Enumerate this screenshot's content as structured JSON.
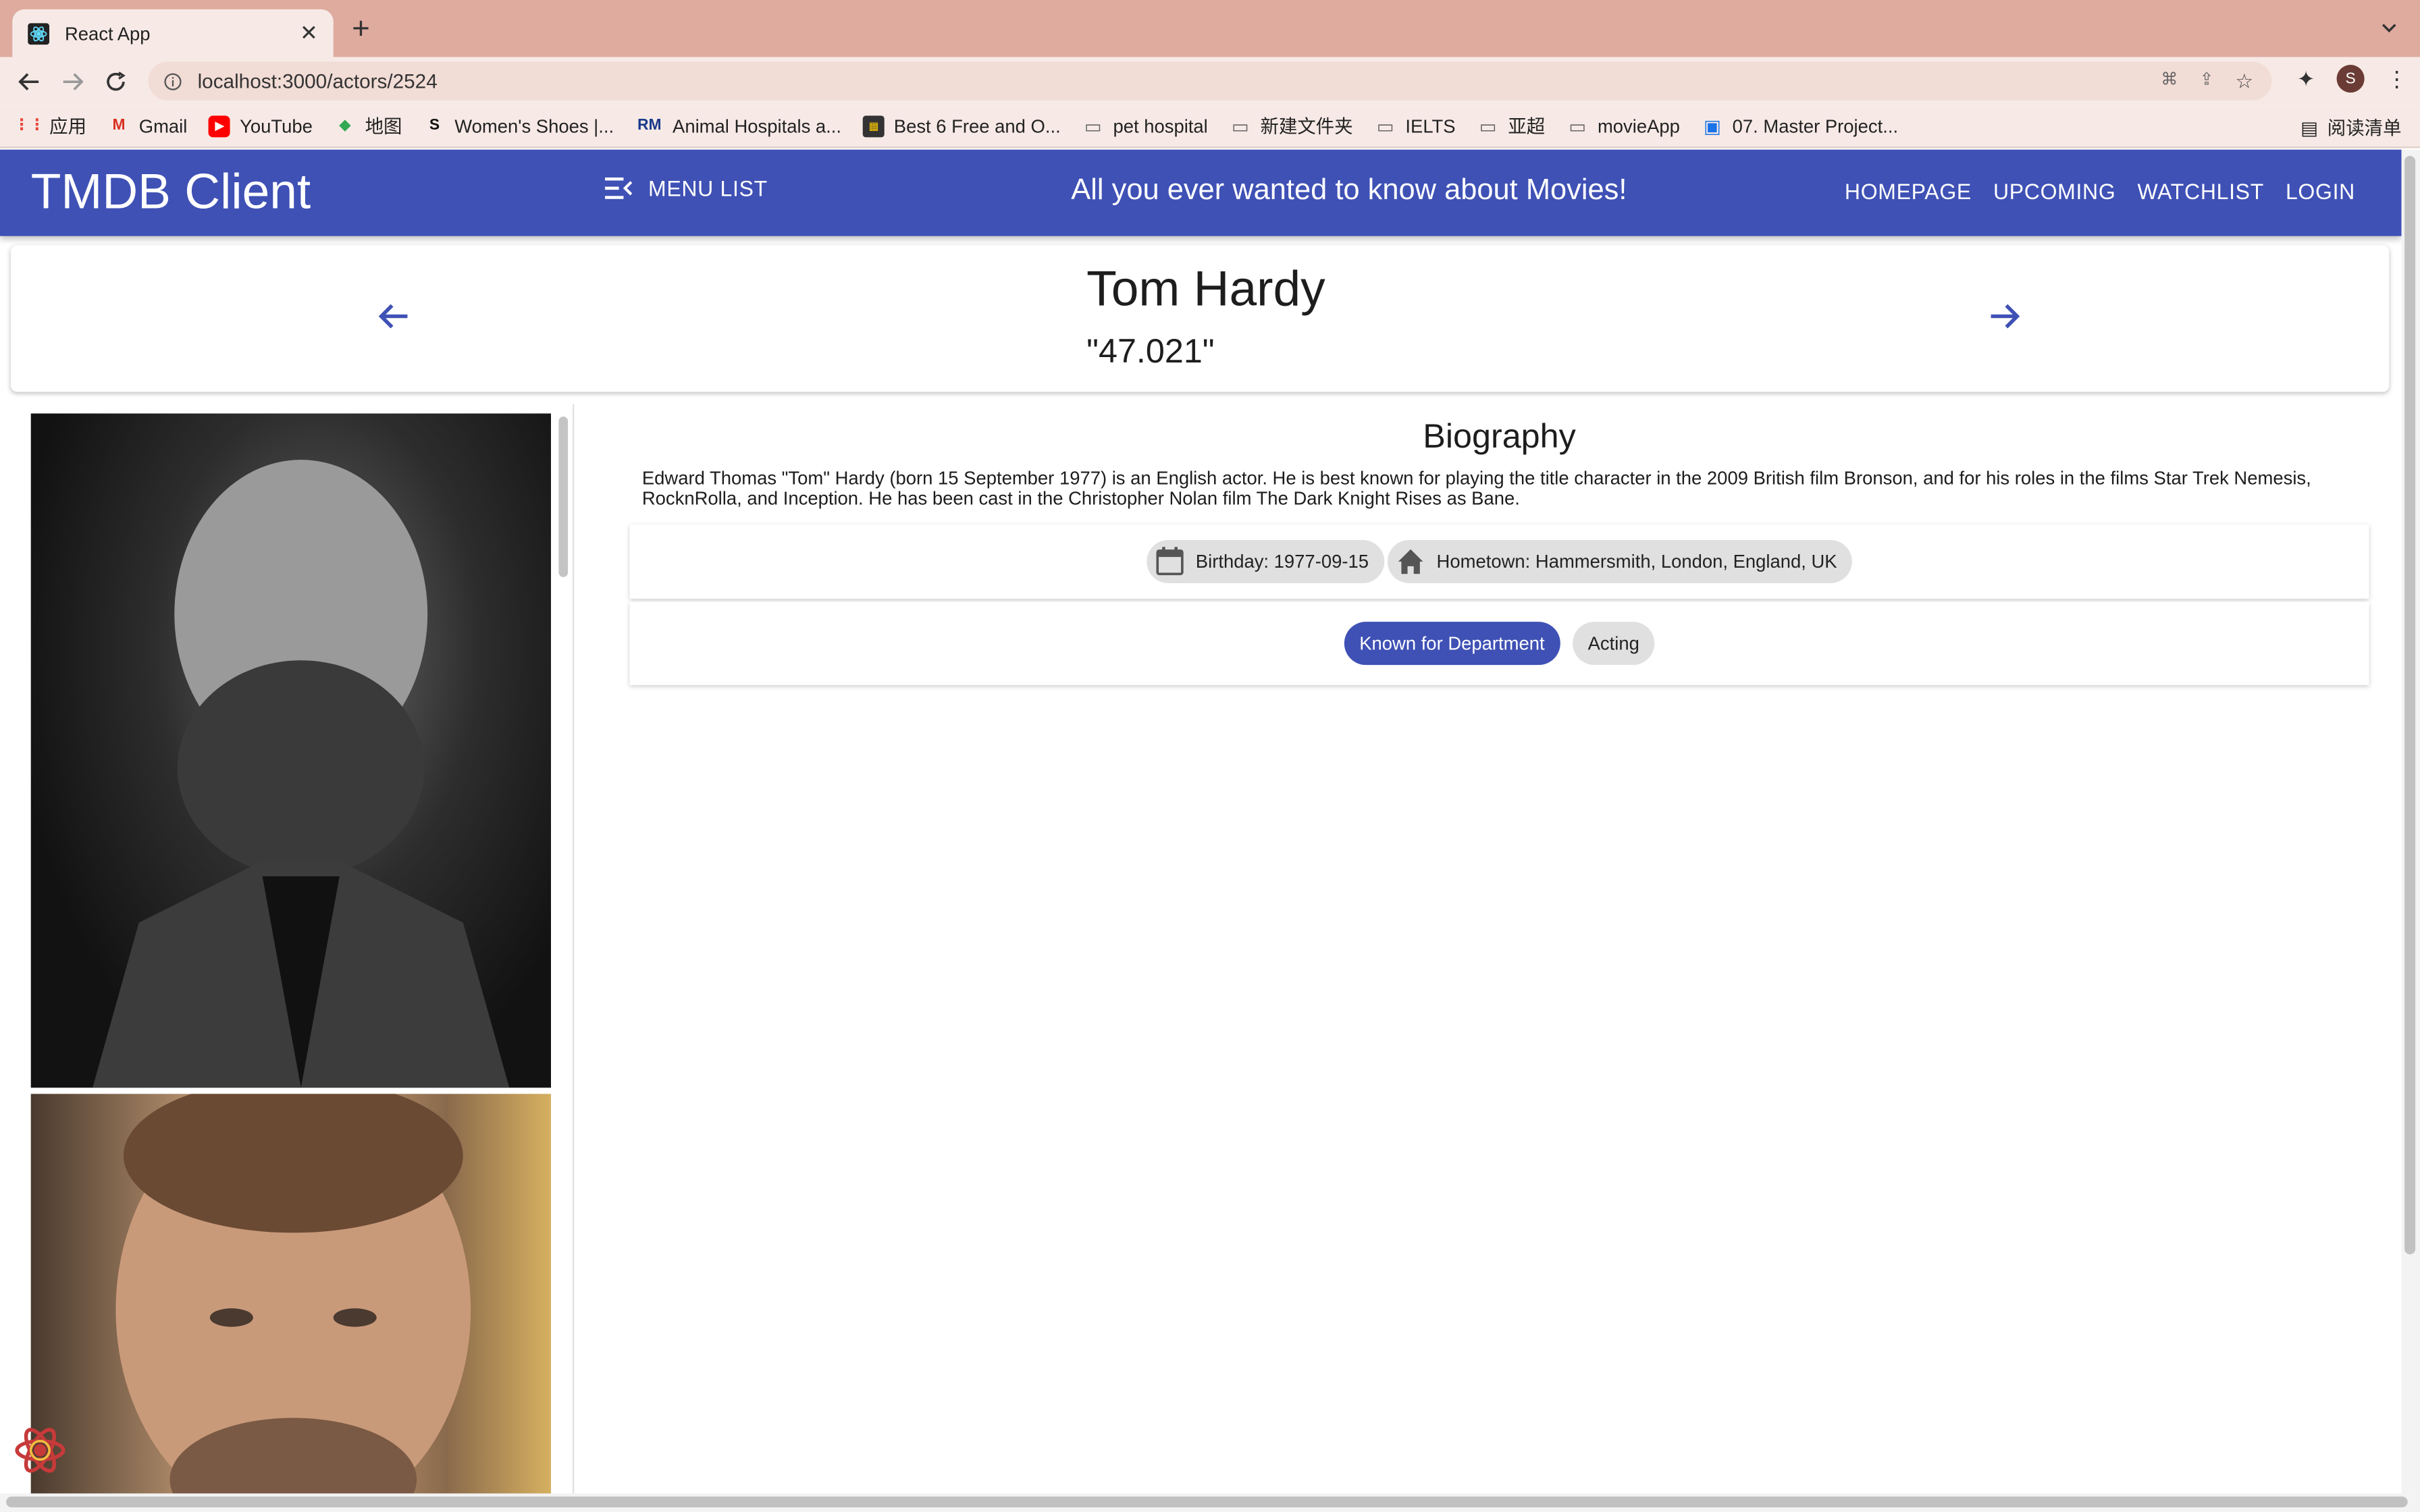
{
  "browser": {
    "tab_title": "React App",
    "url": "localhost:3000/actors/2524",
    "bookmarks": [
      {
        "label": "应用",
        "icon": "apps-grid-icon"
      },
      {
        "label": "Gmail",
        "icon": "gmail-icon"
      },
      {
        "label": "YouTube",
        "icon": "youtube-icon"
      },
      {
        "label": "地图",
        "icon": "maps-icon"
      },
      {
        "label": "Women's Shoes |...",
        "icon": "s-logo-icon"
      },
      {
        "label": "Animal Hospitals a...",
        "icon": "rm-logo-icon"
      },
      {
        "label": "Best 6 Free and O...",
        "icon": "site-icon"
      },
      {
        "label": "pet hospital",
        "icon": "folder-icon"
      },
      {
        "label": "新建文件夹",
        "icon": "folder-icon"
      },
      {
        "label": "IELTS",
        "icon": "folder-icon"
      },
      {
        "label": "亚超",
        "icon": "folder-icon"
      },
      {
        "label": "movieApp",
        "icon": "folder-icon"
      },
      {
        "label": "07. Master Project...",
        "icon": "calendar-icon"
      }
    ],
    "reading_list": "阅读清单",
    "profile_initial": "S"
  },
  "appbar": {
    "brand": "TMDB Client",
    "menu_list": "MENU LIST",
    "tagline": "All you ever wanted to know about Movies!",
    "nav": [
      "HOMEPAGE",
      "UPCOMING",
      "WATCHLIST",
      "LOGIN"
    ]
  },
  "actor": {
    "name": "Tom Hardy",
    "popularity": "\"47.021\"",
    "bio_heading": "Biography",
    "biography": "Edward Thomas \"Tom\" Hardy (born 15 September 1977) is an English actor. He is best known for playing the title character in the 2009 British film Bronson, and for his roles in the films Star Trek Nemesis, RocknRolla, and Inception. He has been cast in the Christopher Nolan film The Dark Knight Rises as Bane.",
    "birthday": "Birthday: 1977-09-15",
    "hometown": "Hometown: Hammersmith, London, England, UK",
    "known_for_label": "Known for Department",
    "department": "Acting"
  },
  "colors": {
    "primary": "#3f51b5",
    "chrome": "#dfab9f"
  }
}
